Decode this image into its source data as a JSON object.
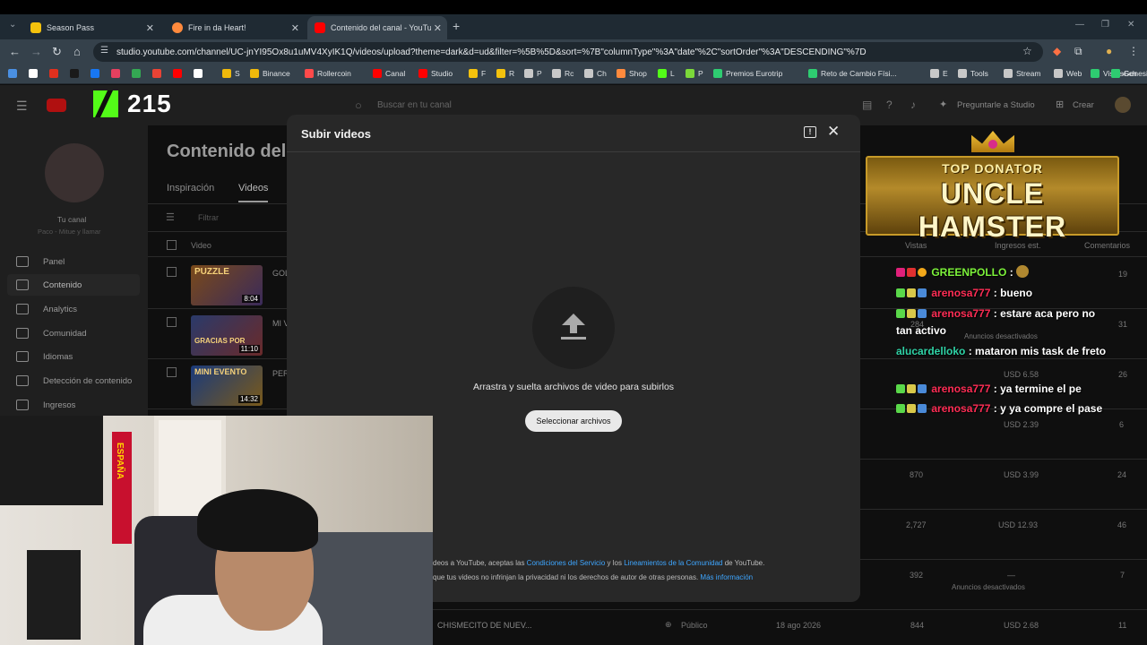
{
  "browser": {
    "tabs": [
      {
        "title": "Season Pass",
        "color": "#f4c20d"
      },
      {
        "title": "Fire in da Heart!",
        "color": "#ff8a3d"
      },
      {
        "title": "Contenido del canal - YouTube",
        "color": "#ff0000"
      }
    ],
    "url": "studio.youtube.com/channel/UC-jnYI95Ox8u1uMV4XyIK1Q/videos/upload?theme=dark&d=ud&filter=%5B%5D&sort=%7B\"columnType\"%3A\"date\"%2C\"sortOrder\"%3A\"DESCENDING\"%7D",
    "bookmarks": [
      "S",
      "Binance",
      "Rollercoin",
      "Canal",
      "Studio",
      "F",
      "R",
      "P",
      "Rc",
      "Ch",
      "Shop",
      "L",
      "P",
      "Premios Eurotrip",
      "Reto de Cambio Físi...",
      "E",
      "Tools",
      "Stream",
      "Web",
      "Vistas",
      "Genesis",
      "Sch"
    ]
  },
  "studio": {
    "search_placeholder": "Buscar en tu canal",
    "ask_studio": "Preguntarle a Studio",
    "create": "Crear",
    "channel_label": "Tu canal",
    "channel_sub": "Paco - Mitue y llamar",
    "sidebar": [
      "Panel",
      "Contenido",
      "Analytics",
      "Comunidad",
      "Idiomas",
      "Detección de contenido",
      "Ingresos"
    ],
    "page_title": "Contenido del",
    "subtabs": [
      "Inspiración",
      "Videos"
    ],
    "filter": "Filtrar",
    "col_video": "Video",
    "col_views": "Vistas",
    "col_income": "Ingresos est.",
    "col_comments": "Comentarios",
    "rows": [
      {
        "thumb": "PUZZLE",
        "title": "GOL...",
        "dur": "8:04",
        "views": "",
        "income": "",
        "comments": "19"
      },
      {
        "thumb": "GRACIAS POR",
        "title": "MI V...",
        "dur": "11:10",
        "views": "284",
        "income": "Anuncios desactivados",
        "comments": "31"
      },
      {
        "thumb": "MINI EVENTO",
        "title": "PER...",
        "dur": "14:32",
        "views": "",
        "income": "USD 6.58",
        "comments": "26"
      },
      {
        "thumb": "",
        "title": "",
        "dur": "",
        "views": "",
        "income": "USD 2.39",
        "comments": "6"
      },
      {
        "thumb": "",
        "title": "",
        "dur": "",
        "views": "870",
        "income": "USD 3.99",
        "comments": "24"
      },
      {
        "thumb": "",
        "title": "",
        "dur": "",
        "views": "2,727",
        "income": "USD 12.93",
        "comments": "46"
      },
      {
        "thumb": "",
        "title": "",
        "dur": "",
        "views": "392",
        "income": "—",
        "comments": "7"
      }
    ],
    "row_extra_note": "Anuncios desactivados",
    "last_row": {
      "title": "CHISMECITO DE NUEV...",
      "visibility": "Público",
      "date": "18 ago 2026",
      "views": "844",
      "income": "USD 2.68",
      "comments": "11"
    }
  },
  "modal": {
    "title": "Subir videos",
    "drop_text": "Arrastra y suelta archivos de video para subirlos",
    "select_button": "Seleccionar archivos",
    "legal1_pre": "deos a YouTube, aceptas las ",
    "legal1_link1": "Condiciones del Servicio",
    "legal1_mid": " y los ",
    "legal1_link2": "Lineamientos de la Comunidad",
    "legal1_post": " de YouTube.",
    "legal2_pre": "que tus videos no infrinjan la privacidad ni los derechos de autor de otras personas. ",
    "legal2_link": "Más información"
  },
  "overlay": {
    "viewer_count": "215",
    "donator_top": "TOP DONATOR",
    "donator_name": "UNCLE HAMSTER",
    "chat": [
      {
        "user": "GREENPOLLO",
        "text": ":",
        "user_color": "#7cf23a"
      },
      {
        "user": "arenosa777",
        "text": ": bueno",
        "user_color": "#ff2d55"
      },
      {
        "user": "arenosa777",
        "text": ": estare aca pero no tan activo",
        "user_color": "#ff2d55"
      },
      {
        "user": "alucardelloko",
        "text": ": mataron mis task de freto",
        "user_color": "#2fd3a6"
      },
      {
        "user": "arenosa777",
        "text": ": ya termine el pe",
        "user_color": "#ff2d55"
      },
      {
        "user": "arenosa777",
        "text": ": y ya compre el pase",
        "user_color": "#ff2d55"
      }
    ],
    "flag_text": "ESPAÑA"
  }
}
